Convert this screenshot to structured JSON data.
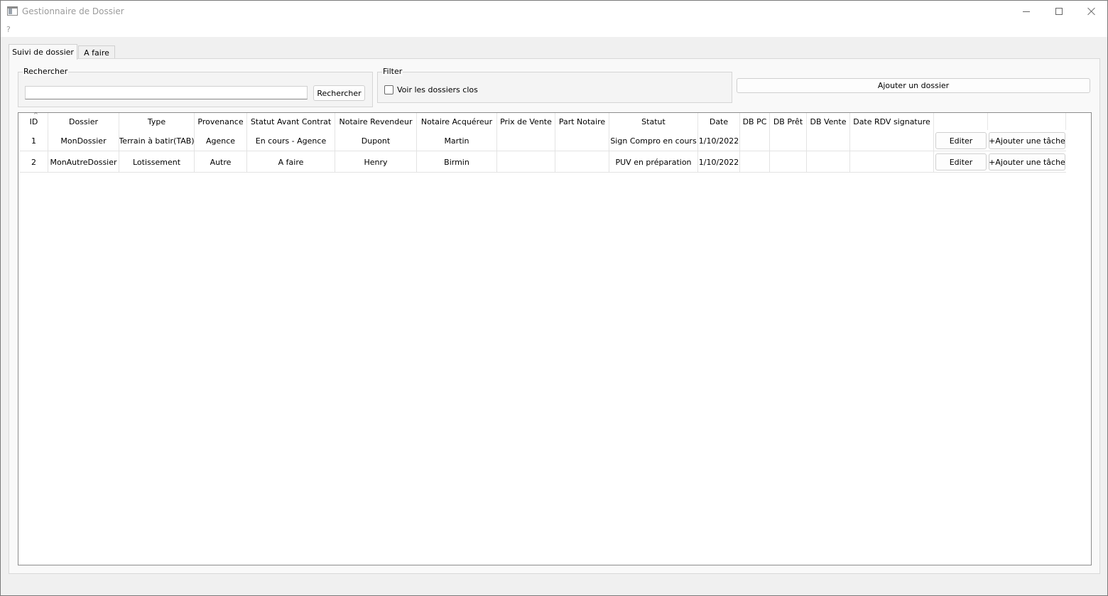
{
  "window": {
    "title": "Gestionnaire de Dossier",
    "menu": "?"
  },
  "tabs": [
    {
      "label": "Suivi de dossier",
      "active": true
    },
    {
      "label": "A faire",
      "active": false
    }
  ],
  "search": {
    "group_title": "Rechercher",
    "input_value": "",
    "button_label": "Rechercher"
  },
  "filter": {
    "group_title": "Filter",
    "checkbox_label": "Voir les dossiers clos",
    "checked": false
  },
  "add_button_label": "Ajouter un dossier",
  "table": {
    "sort_indicator": "^",
    "headers": [
      "ID",
      "Dossier",
      "Type",
      "Provenance",
      "Statut Avant Contrat",
      "Notaire Revendeur",
      "Notaire Acquéreur",
      "Prix de Vente",
      "Part Notaire",
      "Statut",
      "Date",
      "DB PC",
      "DB Prêt",
      "DB Vente",
      "Date RDV signature",
      "",
      ""
    ],
    "rows": [
      {
        "cells": [
          "1",
          "MonDossier",
          "Terrain à batir(TAB)",
          "Agence",
          "En cours - Agence",
          "Dupont",
          "Martin",
          "",
          "",
          "Sign Compro en cours",
          "1/10/2022",
          "",
          "",
          "",
          ""
        ],
        "edit_label": "Editer",
        "add_task_label": "+Ajouter une tâche"
      },
      {
        "cells": [
          "2",
          "MonAutreDossier",
          "Lotissement",
          "Autre",
          "A faire",
          "Henry",
          "Birmin",
          "",
          "",
          "PUV en préparation",
          "1/10/2022",
          "",
          "",
          "",
          ""
        ],
        "edit_label": "Editer",
        "add_task_label": "+Ajouter une tâche"
      }
    ]
  }
}
